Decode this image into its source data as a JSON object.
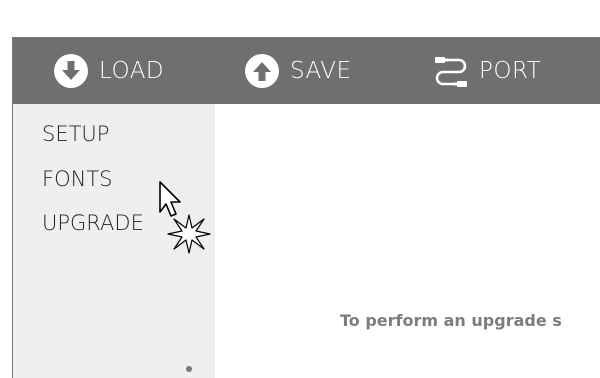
{
  "toolbar": {
    "load_label": "LOAD",
    "save_label": "SAVE",
    "port_label": "PORT",
    "background_color": "#6f6f70",
    "icons": {
      "load": "download-circle-icon",
      "save": "upload-circle-icon",
      "port": "cable-connector-icon"
    }
  },
  "sidebar": {
    "background_color": "#efefef",
    "items": [
      {
        "label": "SETUP"
      },
      {
        "label": "FONTS"
      },
      {
        "label": "UPGRADE"
      }
    ]
  },
  "main": {
    "instruction_text": "To perform an upgrade s"
  },
  "overlay": {
    "cursor_icon": "mouse-pointer-icon",
    "click_icon": "click-burst-icon"
  }
}
